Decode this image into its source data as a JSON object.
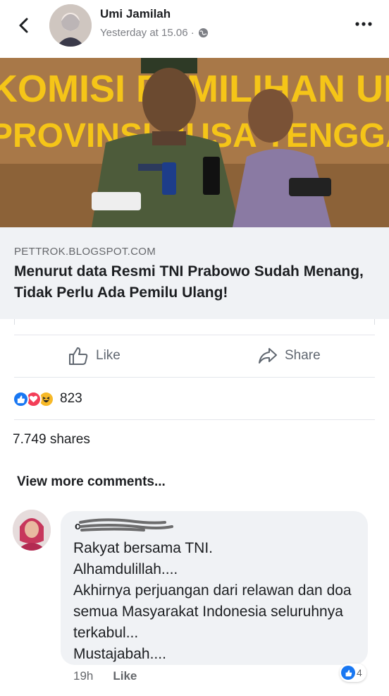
{
  "header": {
    "author": "Umi Jamilah",
    "timestamp": "Yesterday at 15.06 ·",
    "privacy_icon": "globe-icon",
    "back_icon": "chevron-left-icon",
    "more_icon": "ellipsis-icon"
  },
  "photo": {
    "sign_line1": "KOMISI PEMILIHAN UMUM",
    "sign_line2": "PROVINSI NUSA TENGGARA BARAT",
    "sign_color": "#f5c518",
    "wall_color": "#b07e4a"
  },
  "link": {
    "domain": "PETTROK.BLOGSPOT.COM",
    "title": "Menurut data Resmi TNI Prabowo Sudah Menang, Tidak Perlu Ada Pemilu Ulang!"
  },
  "actions": {
    "like_label": "Like",
    "share_label": "Share"
  },
  "reactions": {
    "types": [
      "like",
      "love",
      "haha"
    ],
    "count": "823"
  },
  "shares": "7.749 shares",
  "view_more": "View more comments...",
  "comment": {
    "text": "Rakyat bersama TNI.\nAlhamdulillah....\nAkhirnya perjuangan dari relawan dan doa semua Masyarakat Indonesia seluruhnya terkabul...\nMustajabah....",
    "time": "19h",
    "like_label": "Like",
    "reaction_count": "4"
  },
  "colors": {
    "accent_blue": "#1877f2",
    "love_red": "#f33e58",
    "haha_yellow": "#f7b928"
  }
}
